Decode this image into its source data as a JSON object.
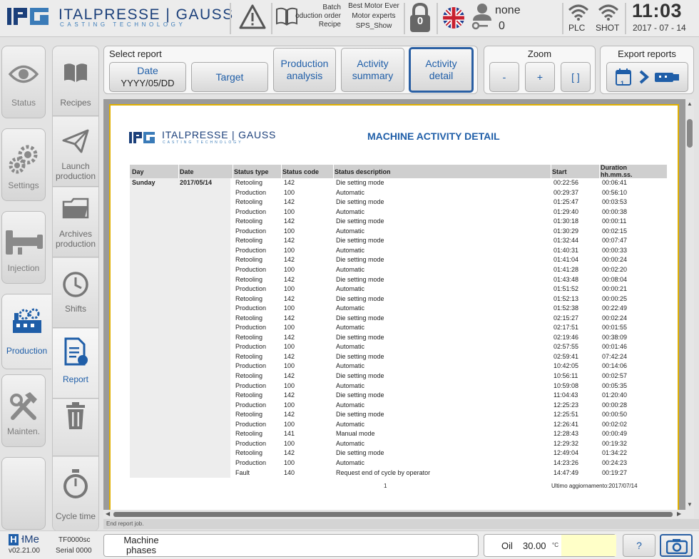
{
  "header": {
    "brand_name": "ITALPRESSE | GAUSS",
    "brand_sub": "CASTING TECHNOLOGY",
    "recipe_info": {
      "line1": "Batch",
      "line2": "Production order",
      "line3": "Recipe"
    },
    "recipe_values": {
      "line1": "Best Motor Ever",
      "line2": "Motor experts",
      "line3": "SPS_Show"
    },
    "lock_count": "0",
    "user_name": "none",
    "user_count": "0",
    "plc_label": "PLC",
    "shot_label": "SHOT",
    "time": "11:03",
    "date": "2017 - 07 - 14"
  },
  "nav": {
    "status": "Status",
    "settings": "Settings",
    "injection": "Injection",
    "production": "Production",
    "mainten": "Mainten.",
    "recipes": "Recipes",
    "launch_production": "Launch\nproduction",
    "archives_production": "Archives\nproduction",
    "shifts": "Shifts",
    "report": "Report",
    "cycle_time": "Cycle time"
  },
  "toolbar": {
    "select_report_title": "Select report",
    "date_label": "Date",
    "date_value": "YYYY/05/DD",
    "target": "Target",
    "production_analysis": "Production analysis",
    "activity_summary": "Activity summary",
    "activity_detail": "Activity detail",
    "zoom_title": "Zoom",
    "zoom_minus": "-",
    "zoom_plus": "+",
    "zoom_fit": "[ ]",
    "export_title": "Export reports",
    "export_day": "1"
  },
  "report": {
    "title": "MACHINE ACTIVITY DETAIL",
    "columns": [
      "Day",
      "Date",
      "Status type",
      "Status code",
      "Status description",
      "Start",
      "Duration\nhh.mm.ss."
    ],
    "day": "Sunday",
    "date": "2017/05/14",
    "rows": [
      [
        "Retooling",
        "142",
        "Die setting mode",
        "00:22:56",
        "00:06:41"
      ],
      [
        "Production",
        "100",
        "Automatic",
        "00:29:37",
        "00:56:10"
      ],
      [
        "Retooling",
        "142",
        "Die setting mode",
        "01:25:47",
        "00:03:53"
      ],
      [
        "Production",
        "100",
        "Automatic",
        "01:29:40",
        "00:00:38"
      ],
      [
        "Retooling",
        "142",
        "Die setting mode",
        "01:30:18",
        "00:00:11"
      ],
      [
        "Production",
        "100",
        "Automatic",
        "01:30:29",
        "00:02:15"
      ],
      [
        "Retooling",
        "142",
        "Die setting mode",
        "01:32:44",
        "00:07:47"
      ],
      [
        "Production",
        "100",
        "Automatic",
        "01:40:31",
        "00:00:33"
      ],
      [
        "Retooling",
        "142",
        "Die setting mode",
        "01:41:04",
        "00:00:24"
      ],
      [
        "Production",
        "100",
        "Automatic",
        "01:41:28",
        "00:02:20"
      ],
      [
        "Retooling",
        "142",
        "Die setting mode",
        "01:43:48",
        "00:08:04"
      ],
      [
        "Production",
        "100",
        "Automatic",
        "01:51:52",
        "00:00:21"
      ],
      [
        "Retooling",
        "142",
        "Die setting mode",
        "01:52:13",
        "00:00:25"
      ],
      [
        "Production",
        "100",
        "Automatic",
        "01:52:38",
        "00:22:49"
      ],
      [
        "Retooling",
        "142",
        "Die setting mode",
        "02:15:27",
        "00:02:24"
      ],
      [
        "Production",
        "100",
        "Automatic",
        "02:17:51",
        "00:01:55"
      ],
      [
        "Retooling",
        "142",
        "Die setting mode",
        "02:19:46",
        "00:38:09"
      ],
      [
        "Production",
        "100",
        "Automatic",
        "02:57:55",
        "00:01:46"
      ],
      [
        "Retooling",
        "142",
        "Die setting mode",
        "02:59:41",
        "07:42:24"
      ],
      [
        "Production",
        "100",
        "Automatic",
        "10:42:05",
        "00:14:06"
      ],
      [
        "Retooling",
        "142",
        "Die setting mode",
        "10:56:11",
        "00:02:57"
      ],
      [
        "Production",
        "100",
        "Automatic",
        "10:59:08",
        "00:05:35"
      ],
      [
        "Retooling",
        "142",
        "Die setting mode",
        "11:04:43",
        "01:20:40"
      ],
      [
        "Production",
        "100",
        "Automatic",
        "12:25:23",
        "00:00:28"
      ],
      [
        "Retooling",
        "142",
        "Die setting mode",
        "12:25:51",
        "00:00:50"
      ],
      [
        "Production",
        "100",
        "Automatic",
        "12:26:41",
        "00:02:02"
      ],
      [
        "Retooling",
        "141",
        "Manual mode",
        "12:28:43",
        "00:00:49"
      ],
      [
        "Production",
        "100",
        "Automatic",
        "12:29:32",
        "00:19:32"
      ],
      [
        "Retooling",
        "142",
        "Die setting mode",
        "12:49:04",
        "01:34:22"
      ],
      [
        "Production",
        "100",
        "Automatic",
        "14:23:26",
        "00:24:23"
      ],
      [
        "Fault",
        "140",
        "Request end of cycle by operator",
        "14:47:49",
        "00:19:27"
      ]
    ],
    "page_number": "1",
    "last_update": "Ultimo aggiornamento:2017/07/14"
  },
  "statusbar": {
    "message": "End report job."
  },
  "footer": {
    "hme_brand": "HMe",
    "version": "v02.21.00",
    "machine_code": "TF0000sc",
    "serial": "Serial 0000",
    "machine_phases": "Machine phases",
    "oil_label": "Oil",
    "oil_value": "30.00",
    "oil_unit": "°C",
    "help": "?"
  }
}
